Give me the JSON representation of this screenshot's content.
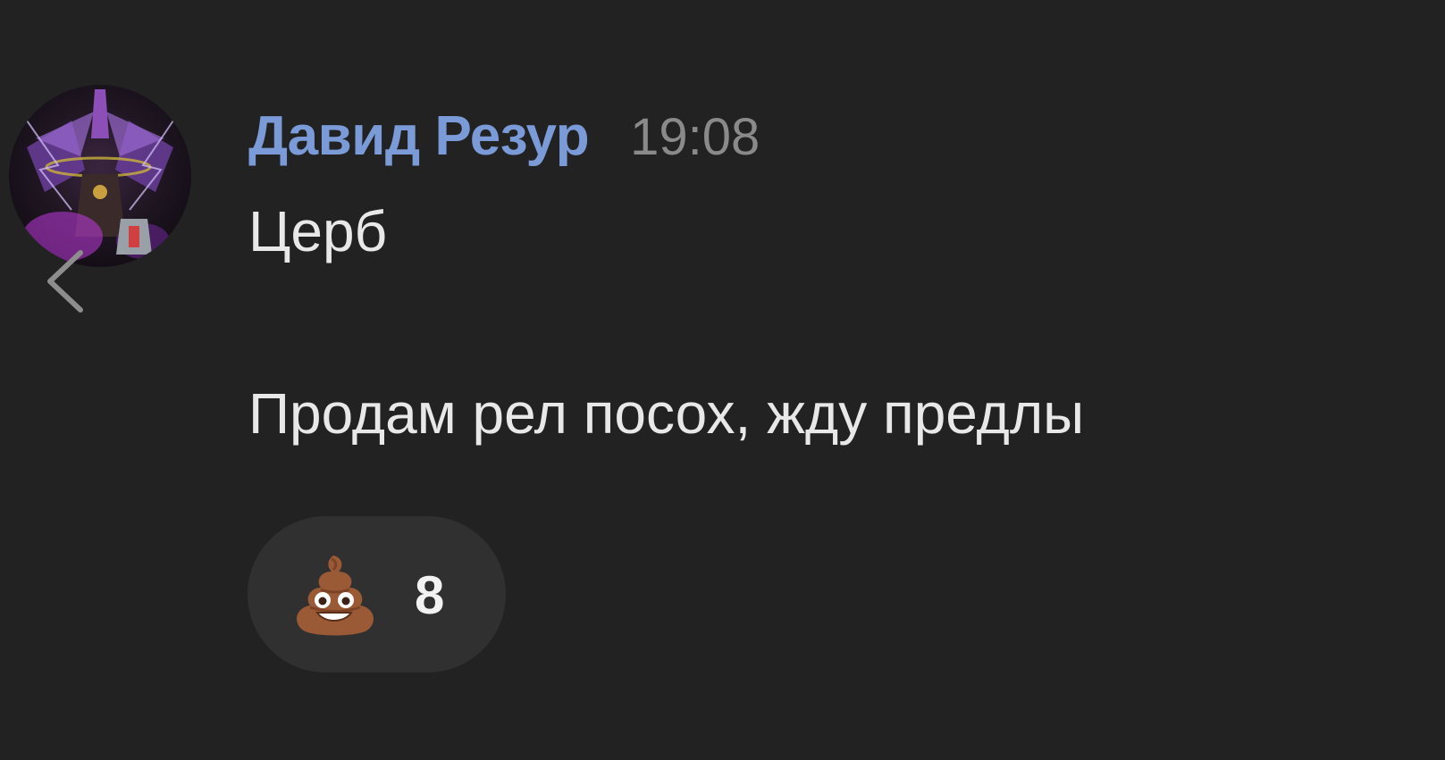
{
  "message": {
    "author": "Давид Резур",
    "time": "19:08",
    "lines": [
      "Церб",
      "Продам рел посох, жду предлы"
    ]
  },
  "reaction": {
    "emoji_icon": "pile-of-poo-icon",
    "count": "8"
  },
  "colors": {
    "background": "#222222",
    "author_name": "#7b9bd8",
    "timestamp": "#8a8a8a",
    "message_text": "#e8e8e8",
    "reaction_pill": "#303030"
  }
}
